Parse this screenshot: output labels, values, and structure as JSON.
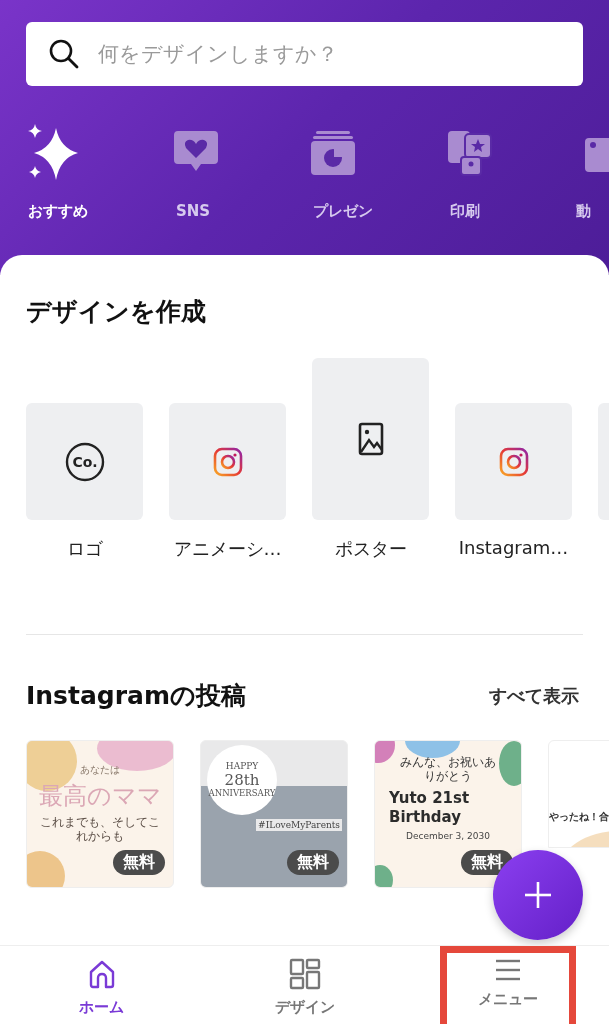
{
  "search": {
    "placeholder": "何をデザインしますか？"
  },
  "categories": [
    {
      "label": "おすすめ",
      "kind": "sparkle",
      "selected": true
    },
    {
      "label": "SNS",
      "kind": "heart",
      "selected": false
    },
    {
      "label": "プレゼン",
      "kind": "slides",
      "selected": false
    },
    {
      "label": "印刷",
      "kind": "print",
      "selected": false
    },
    {
      "label": "動",
      "kind": "video",
      "selected": false
    }
  ],
  "create": {
    "title": "デザインを作成",
    "items": [
      {
        "label": "ロゴ",
        "kind": "logo",
        "icon_text": "Co."
      },
      {
        "label": "アニメーシ…",
        "kind": "instagram"
      },
      {
        "label": "ポスター",
        "kind": "poster"
      },
      {
        "label": "Instagram…",
        "kind": "instagram"
      },
      {
        "kind": "partial"
      }
    ]
  },
  "instagram": {
    "title": "Instagramの投稿",
    "see_all": "すべて表示",
    "templates": [
      {
        "kind": "mama",
        "badge": "無料",
        "texts": [
          "あなたは",
          "最高のママ",
          "これまでも、そしてこれからも"
        ]
      },
      {
        "kind": "anniversary",
        "badge": "無料",
        "texts": [
          "HAPPY",
          "28th",
          "ANNIVERSARY",
          "#ILoveMyParents"
        ]
      },
      {
        "kind": "birthday",
        "badge": "無料",
        "texts": [
          "みんな、お祝いありがとう",
          "Yuto 21st Birthday",
          "December 3, 2030"
        ]
      },
      {
        "kind": "partial",
        "texts": [
          "やったね！合"
        ]
      }
    ]
  },
  "nav": [
    {
      "label": "ホーム",
      "kind": "home",
      "selected": true,
      "highlighted": false
    },
    {
      "label": "デザイン",
      "kind": "grid",
      "selected": false,
      "highlighted": false
    },
    {
      "label": "メニュー",
      "kind": "menu",
      "selected": false,
      "highlighted": true
    }
  ]
}
